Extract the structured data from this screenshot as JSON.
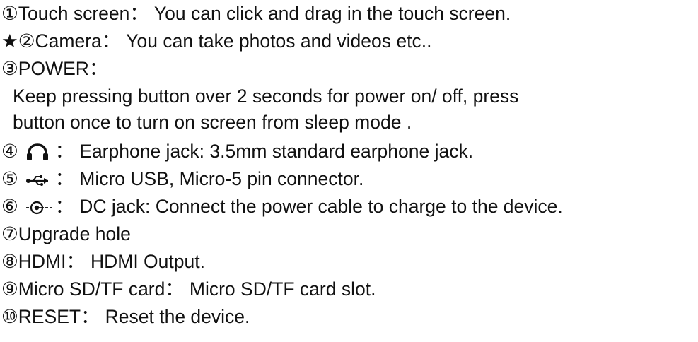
{
  "items": [
    {
      "num": "①",
      "star": "",
      "icon": "",
      "label": "Touch screen",
      "sep": "：",
      "text": "You can click and drag in the touch screen."
    },
    {
      "num": "②",
      "star": "★",
      "icon": "",
      "label": "Camera",
      "sep": "：",
      "text": "You can take photos and videos etc.."
    },
    {
      "num": "③",
      "star": "",
      "icon": "",
      "label": "POWER",
      "sep": "：",
      "text": ""
    },
    {
      "num": "",
      "star": "",
      "icon": "",
      "label": "",
      "sep": "",
      "text": "Keep pressing button over 2 seconds for power on/ off, press"
    },
    {
      "num": "",
      "star": "",
      "icon": "",
      "label": "",
      "sep": "",
      "text": "button once to turn on screen from sleep mode ."
    },
    {
      "num": "④",
      "star": "",
      "icon": "headphone-icon",
      "label": "",
      "sep": "：",
      "text": "Earphone jack: 3.5mm standard earphone jack."
    },
    {
      "num": "⑤",
      "star": "",
      "icon": "usb-icon",
      "label": "",
      "sep": "：",
      "text": "Micro USB, Micro-5 pin connector."
    },
    {
      "num": "⑥",
      "star": "",
      "icon": "dc-jack-icon",
      "label": "",
      "sep": "：",
      "text": "DC jack: Connect the power cable to charge to the device."
    },
    {
      "num": "⑦",
      "star": "",
      "icon": "",
      "label": "Upgrade hole",
      "sep": "",
      "text": ""
    },
    {
      "num": "⑧",
      "star": "",
      "icon": "",
      "label": "HDMI",
      "sep": "：",
      "text": "HDMI Output."
    },
    {
      "num": "⑨",
      "star": "",
      "icon": "",
      "label": "Micro SD/TF card",
      "sep": "：",
      "text": "Micro SD/TF card slot."
    },
    {
      "num": "⑩",
      "star": "",
      "icon": "",
      "label": "RESET",
      "sep": "：",
      "text": "Reset the device."
    }
  ]
}
